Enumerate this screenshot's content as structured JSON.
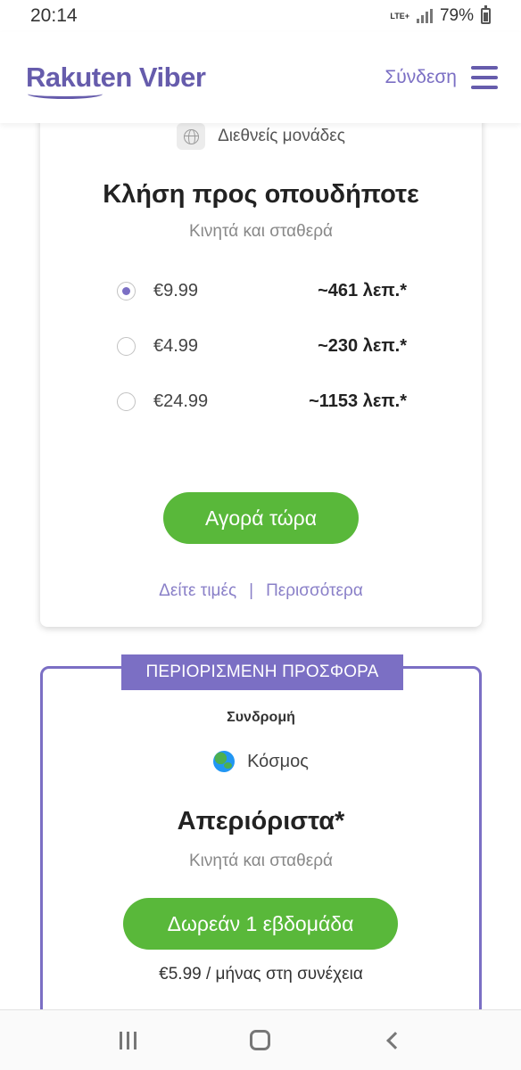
{
  "status_bar": {
    "time": "20:14",
    "network": "LTE+",
    "battery": "79%"
  },
  "header": {
    "logo": "Rakuten Viber",
    "signin": "Σύνδεση",
    "menu_icon": "hamburger-menu-icon"
  },
  "plan_card": {
    "scope_icon": "globe-icon",
    "scope_label": "Διεθνείς μονάδες",
    "title": "Κλήση προς οπουδήποτε",
    "subtitle": "Κινητά και σταθερά",
    "options": [
      {
        "price": "€9.99",
        "minutes": "~461 λεπ.*",
        "selected": true
      },
      {
        "price": "€4.99",
        "minutes": "~230 λεπ.*",
        "selected": false
      },
      {
        "price": "€24.99",
        "minutes": "~1153 λεπ.*",
        "selected": false
      }
    ],
    "buy_label": "Αγορά τώρα",
    "rates_link": "Δείτε τιμές",
    "separator": "|",
    "more_link": "Περισσότερα"
  },
  "offer_card": {
    "badge": "ΠΕΡΙΟΡΙΣΜΕΝΗ ΠΡΟΣΦΟΡΑ",
    "type_label": "Συνδρομή",
    "region_icon": "earth-globe-icon",
    "region_label": "Κόσμος",
    "title": "Απεριόριστα*",
    "subtitle": "Κινητά και σταθερά",
    "trial_label": "Δωρεάν 1 εβδομάδα",
    "then_price": "€5.99 / μήνας στη συνέχεια"
  },
  "colors": {
    "brand_purple": "#665cac",
    "accent_purple": "#7b6fc4",
    "button_green": "#59b83a"
  }
}
